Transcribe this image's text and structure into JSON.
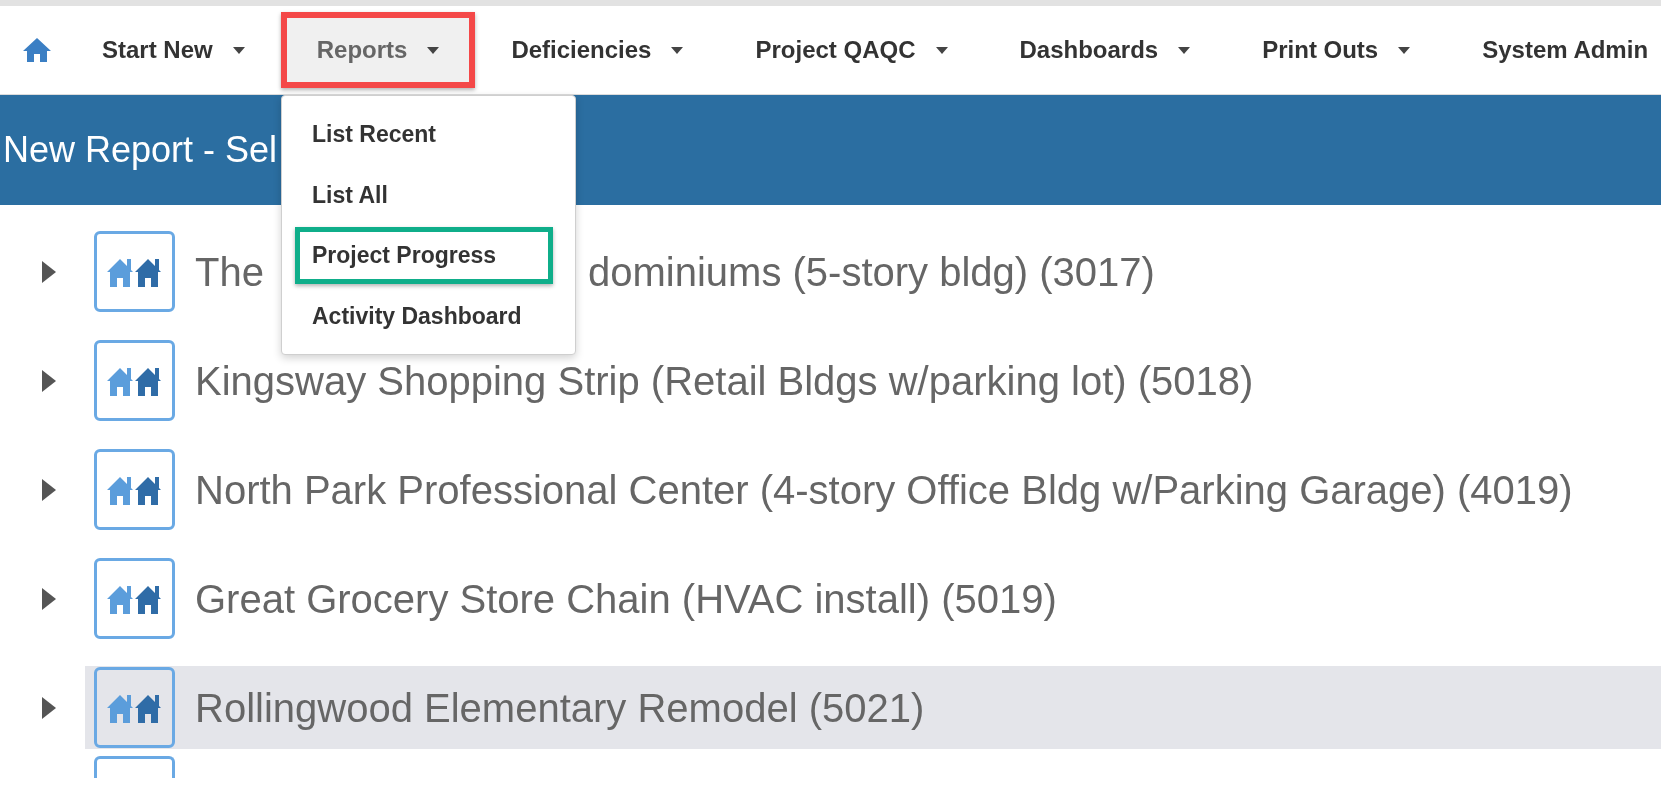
{
  "nav": {
    "items": [
      {
        "label": "Start New",
        "selected": false,
        "annotated": false
      },
      {
        "label": "Reports",
        "selected": true,
        "annotated": true
      },
      {
        "label": "Deficiencies",
        "selected": false,
        "annotated": false
      },
      {
        "label": "Project QAQC",
        "selected": false,
        "annotated": false
      },
      {
        "label": "Dashboards",
        "selected": false,
        "annotated": false
      },
      {
        "label": "Print Outs",
        "selected": false,
        "annotated": false
      },
      {
        "label": "System Admin",
        "selected": false,
        "annotated": false
      }
    ]
  },
  "dropdown": {
    "items": [
      {
        "label": "List Recent",
        "annotated": false
      },
      {
        "label": "List All",
        "annotated": false
      },
      {
        "label": "Project Progress",
        "annotated": true
      },
      {
        "label": "Activity Dashboard",
        "annotated": false
      }
    ]
  },
  "banner": {
    "title": "New Report - Sel"
  },
  "projects": [
    {
      "label_parts": [
        "The",
        "dominiums (5-story bldg) (3017)"
      ],
      "selected": false
    },
    {
      "label_parts": [
        "Kingsway Shopping Strip (Retail Bldgs w/parking lot) (5018)"
      ],
      "selected": false
    },
    {
      "label_parts": [
        "North Park Professional Center (4-story Office Bldg w/Parking Garage) (4019)"
      ],
      "selected": false
    },
    {
      "label_parts": [
        "Great Grocery Store Chain (HVAC install) (5019)"
      ],
      "selected": false
    },
    {
      "label_parts": [
        "Rollingwood Elementary Remodel (5021)"
      ],
      "selected": true
    }
  ]
}
